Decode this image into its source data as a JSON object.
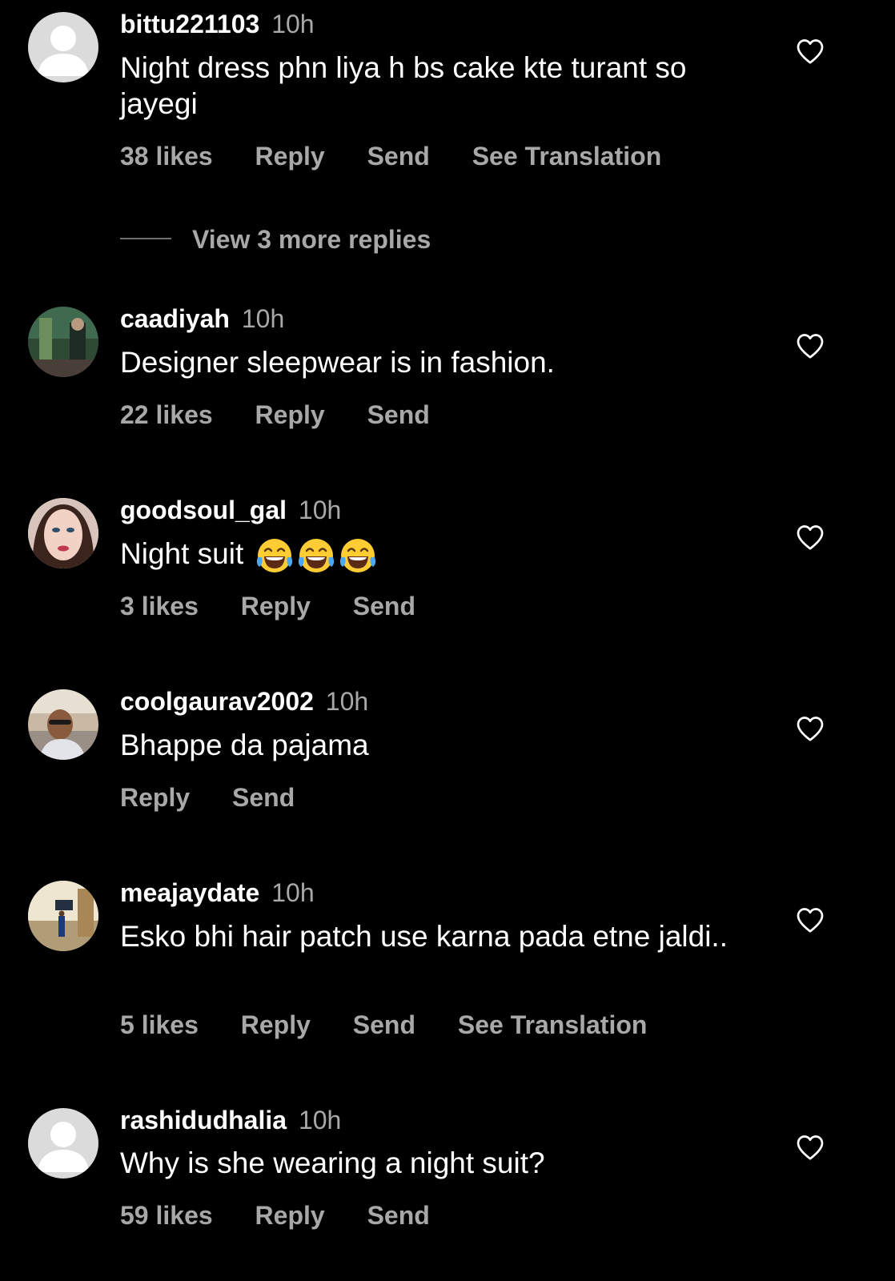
{
  "view_more_replies": "View 3 more replies",
  "comments": [
    {
      "username": "bittu221103",
      "time": "10h",
      "text": "Night dress phn liya h bs cake kte turant so jayegi",
      "likes": "38 likes",
      "reply": "Reply",
      "send": "Send",
      "translation": "See Translation"
    },
    {
      "username": "caadiyah",
      "time": "10h",
      "text": "Designer sleepwear is in fashion.",
      "likes": "22 likes",
      "reply": "Reply",
      "send": "Send"
    },
    {
      "username": "goodsoul_gal",
      "time": "10h",
      "text": "Night suit",
      "emoji": "laughing-tears-emoji",
      "likes": "3 likes",
      "reply": "Reply",
      "send": "Send"
    },
    {
      "username": "coolgaurav2002",
      "time": "10h",
      "text": "Bhappe da pajama",
      "reply": "Reply",
      "send": "Send"
    },
    {
      "username": "meajaydate",
      "time": "10h",
      "text": "Esko bhi hair patch  use karna pada etne jaldi..",
      "likes": "5 likes",
      "reply": "Reply",
      "send": "Send",
      "translation": "See Translation"
    },
    {
      "username": "rashidudhalia",
      "time": "10h",
      "text": "Why is she wearing a night suit?",
      "likes": "59 likes",
      "reply": "Reply",
      "send": "Send"
    }
  ],
  "colors": {
    "background": "#000000",
    "primary_text": "#ffffff",
    "secondary_text": "#a8a8a8"
  },
  "icons": {
    "like": "heart-outline-icon",
    "default_avatar": "default-avatar-icon"
  }
}
